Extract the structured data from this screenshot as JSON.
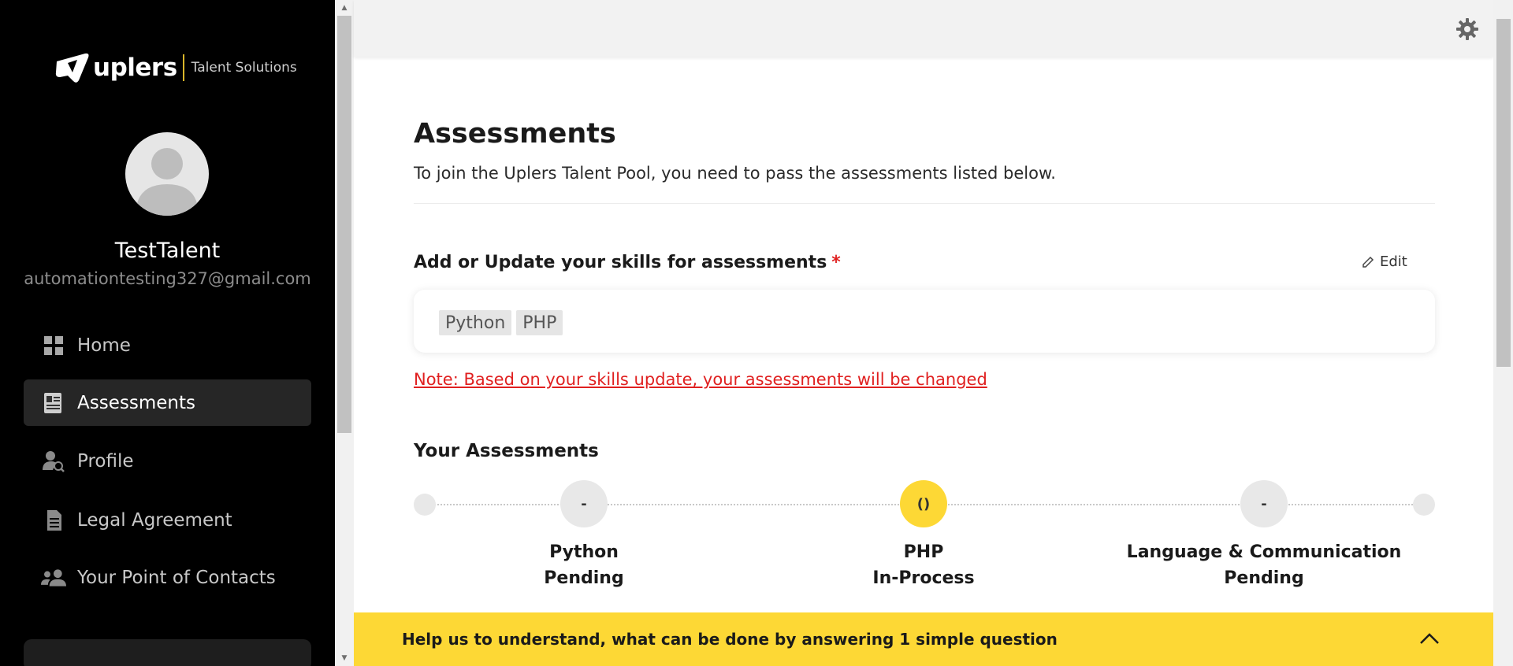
{
  "brand": {
    "name": "uplers",
    "tagline": "Talent Solutions",
    "accent_color": "#fdd835"
  },
  "user": {
    "name": "TestTalent",
    "email": "automationtesting327@gmail.com"
  },
  "sidebar": {
    "items": [
      {
        "label": "Home",
        "icon": "grid-icon",
        "active": false
      },
      {
        "label": "Assessments",
        "icon": "assessment-card-icon",
        "active": true
      },
      {
        "label": "Profile",
        "icon": "person-search-icon",
        "active": false
      },
      {
        "label": "Legal Agreement",
        "icon": "document-icon",
        "active": false
      },
      {
        "label": "Your Point of Contacts",
        "icon": "contacts-icon",
        "active": false
      }
    ]
  },
  "main": {
    "title": "Assessments",
    "subtitle": "To join the Uplers Talent Pool, you need to pass the assessments listed below.",
    "skills_section": {
      "label": "Add or Update your skills for assessments",
      "required_marker": "*",
      "edit_label": "Edit",
      "skills": [
        "Python",
        "PHP"
      ],
      "note": "Note: Based on your skills update, your assessments will be changed"
    },
    "assessments_section": {
      "title": "Your Assessments",
      "steps": [
        {
          "name": "Python",
          "status": "Pending",
          "marker": "-",
          "active": false
        },
        {
          "name": "PHP",
          "status": "In-Process",
          "marker": "()",
          "active": true
        },
        {
          "name": "Language & Communication",
          "status": "Pending",
          "marker": "-",
          "active": false
        }
      ]
    }
  },
  "help_bar": {
    "text": "Help us to understand, what can be done by answering 1 simple question"
  }
}
